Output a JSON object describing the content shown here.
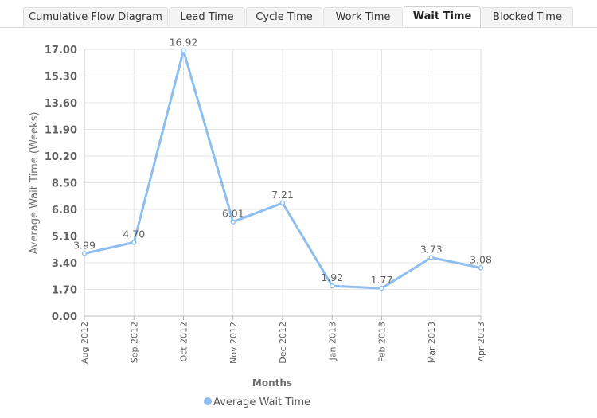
{
  "tabs": [
    {
      "label": "Cumulative Flow Diagram",
      "active": false
    },
    {
      "label": "Lead Time",
      "active": false
    },
    {
      "label": "Cycle Time",
      "active": false
    },
    {
      "label": "Work Time",
      "active": false
    },
    {
      "label": "Wait Time",
      "active": true
    },
    {
      "label": "Blocked Time",
      "active": false
    }
  ],
  "chart_data": {
    "type": "line",
    "ylabel": "Average Wait Time (Weeks)",
    "xlabel": "Months",
    "ylim": [
      0,
      17
    ],
    "yticks": [
      "0.00",
      "1.70",
      "3.40",
      "5.10",
      "6.80",
      "8.50",
      "10.20",
      "11.90",
      "13.60",
      "15.30",
      "17.00"
    ],
    "categories": [
      "Aug 2012",
      "Sep 2012",
      "Oct 2012",
      "Nov 2012",
      "Dec 2012",
      "Jan 2013",
      "Feb 2013",
      "Mar 2013",
      "Apr 2013"
    ],
    "series": [
      {
        "name": "Average Wait Time",
        "values": [
          3.99,
          4.7,
          16.92,
          6.01,
          7.21,
          1.92,
          1.77,
          3.73,
          3.08
        ],
        "labels": [
          "3.99",
          "4.70",
          "16.92",
          "6.01",
          "7.21",
          "1.92",
          "1.77",
          "3.73",
          "3.08"
        ],
        "color": "#8ebef0"
      }
    ],
    "grid": true,
    "legend_position": "bottom-center"
  }
}
